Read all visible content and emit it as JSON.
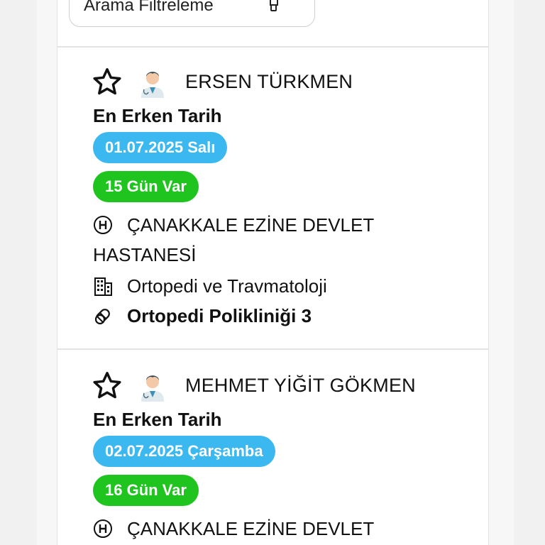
{
  "filter": {
    "label": "Arama Filtreleme"
  },
  "cards": [
    {
      "doctor": "ERSEN TÜRKMEN",
      "earliest_label": "En Erken Tarih",
      "date": "01.07.2025 Salı",
      "days": "15 Gün Var",
      "hospital": "ÇANAKKALE EZİNE DEVLET HASTANESİ",
      "department": "Ortopedi ve Travmatoloji",
      "clinic": "Ortopedi Polikliniği 3"
    },
    {
      "doctor": "MEHMET YİĞİT GÖKMEN",
      "earliest_label": "En Erken Tarih",
      "date": "02.07.2025 Çarşamba",
      "days": "16 Gün Var",
      "hospital": "ÇANAKKALE EZİNE DEVLET"
    }
  ],
  "icons": {
    "favorite": "star-outline-icon",
    "doctor": "doctor-avatar-icon",
    "hospital": "hospital-h-icon",
    "department": "building-icon",
    "clinic": "pill-icon",
    "filter": "filter-icon"
  },
  "colors": {
    "date_pill": "#3bb8f0",
    "days_pill": "#1fc41f"
  }
}
